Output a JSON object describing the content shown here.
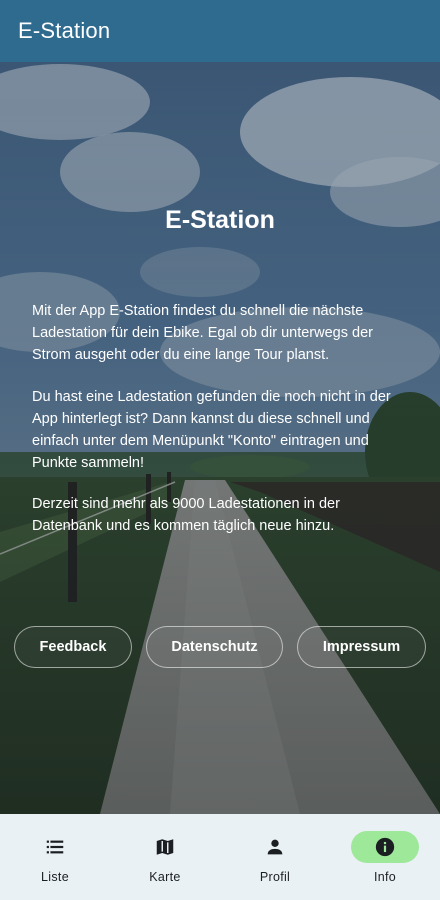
{
  "appbar": {
    "title": "E-Station"
  },
  "hero": {
    "title": "E-Station",
    "paragraphs": [
      "Mit der App E-Station findest du schnell die nächste Ladestation für dein Ebike. Egal ob dir unterwegs der Strom ausgeht oder du eine lange Tour planst.",
      "Du hast eine Ladestation gefunden die noch nicht in der App hinterlegt ist? Dann kannst du diese schnell und einfach unter dem Menüpunkt \"Konto\" eintragen und Punkte sammeln!",
      "Derzeit sind mehr als 9000 Ladestationen in der Datenbank und es kommen täglich neue hinzu."
    ],
    "buttons": {
      "feedback": "Feedback",
      "datenschutz": "Datenschutz",
      "impressum": "Impressum"
    }
  },
  "bottom_nav": {
    "items": [
      {
        "label": "Liste",
        "icon": "list-icon",
        "active": false
      },
      {
        "label": "Karte",
        "icon": "map-icon",
        "active": false
      },
      {
        "label": "Profil",
        "icon": "person-icon",
        "active": false
      },
      {
        "label": "Info",
        "icon": "info-icon",
        "active": true
      }
    ]
  },
  "colors": {
    "appbar": "#2f6b8f",
    "nav_background": "#eaf1f4",
    "active_indicator": "#9ee89a"
  }
}
